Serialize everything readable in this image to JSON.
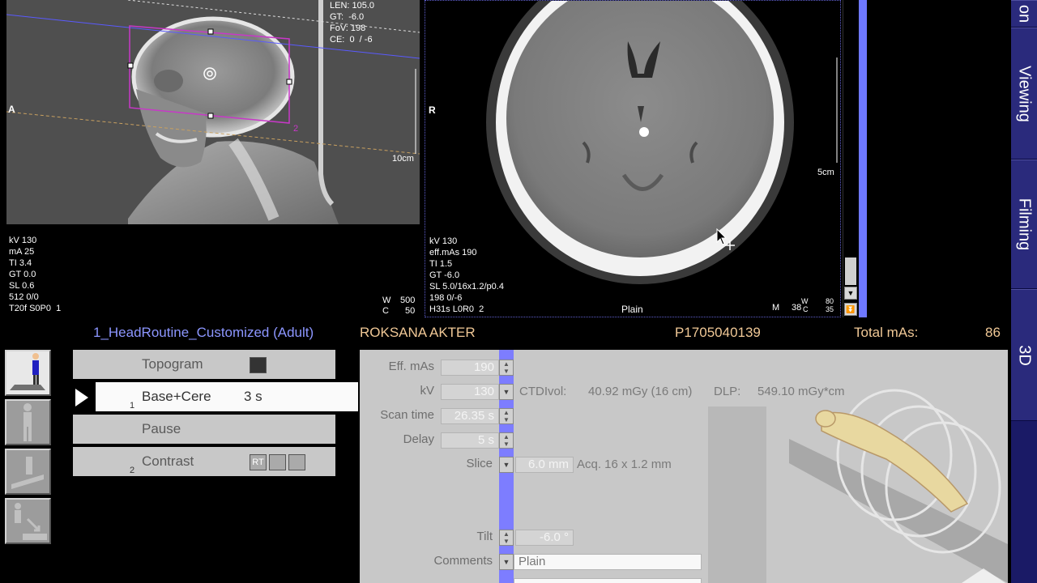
{
  "topogram": {
    "header_lines": [
      "LEN: 105.0",
      "GT:  -6.0",
      "FoV: 198",
      "CE:  0  / -6"
    ],
    "side_label": "A",
    "scale_label": "10cm",
    "params": [
      "kV 130",
      "mA 25",
      "TI 3.4",
      "GT 0.0",
      "SL 0.6",
      "512 0/0",
      "T20f S0P0  1"
    ],
    "window": {
      "w_label": "W",
      "w_value": "500",
      "c_label": "C",
      "c_value": "50"
    },
    "box_marker": "2"
  },
  "axial": {
    "side_label": "R",
    "scale_label": "5cm",
    "params": [
      "kV 130",
      "eff.mAs 190",
      "TI 1.5",
      "GT -6.0",
      "SL 5.0/16x1.2/p0.4",
      "198 0/-6",
      "H31s L0R0  2"
    ],
    "series_label": "Plain",
    "m_label": "M",
    "m_value": "38",
    "w_label": "W",
    "c_label": "C",
    "w_value": "80",
    "c_value": "35"
  },
  "info": {
    "protocol": "1_HeadRoutine_Customized (Adult)",
    "patient_name": "ROKSANA AKTER",
    "patient_id": "P1705040139",
    "total_mas_label": "Total mAs:",
    "total_mas_value": "86"
  },
  "steps": [
    {
      "label": "Topogram",
      "num": "",
      "duration": ""
    },
    {
      "label": "Base+Cere",
      "num": "1",
      "duration": "3 s"
    },
    {
      "label": "Pause",
      "num": "",
      "duration": ""
    },
    {
      "label": "Contrast",
      "num": "2",
      "duration": ""
    }
  ],
  "contrast_rt_label": "RT",
  "params": {
    "eff_mas_label": "Eff. mAs",
    "eff_mas_value": "190",
    "kv_label": "kV",
    "kv_value": "130",
    "ctdivol_label": "CTDIvol:",
    "ctdivol_value": "40.92 mGy (16 cm)",
    "dlp_label": "DLP:",
    "dlp_value": "549.10 mGy*cm",
    "scan_time_label": "Scan time",
    "scan_time_value": "26.35 s",
    "delay_label": "Delay",
    "delay_value": "5 s",
    "slice_label": "Slice",
    "slice_value": "6.0 mm",
    "acq_label": "Acq. 16 x 1.2 mm",
    "tilt_label": "Tilt",
    "tilt_value": "-6.0 °",
    "comments_label": "Comments",
    "comments_value": "Plain"
  },
  "right_tabs": [
    "on",
    "Viewing",
    "Filming",
    "3D"
  ]
}
